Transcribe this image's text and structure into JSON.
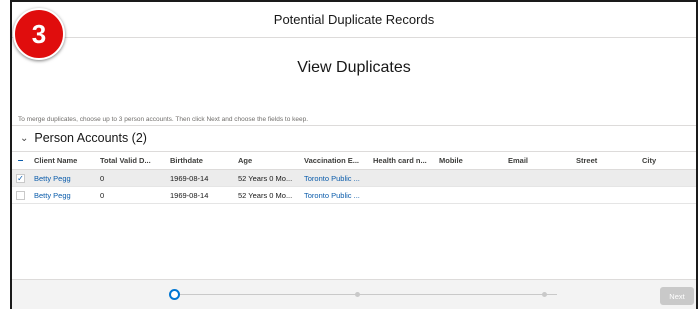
{
  "badge": {
    "number": "3"
  },
  "modal": {
    "title": "Potential Duplicate Records",
    "subtitle": "View Duplicates",
    "instructions": "To merge duplicates, choose up to 3 person accounts. Then click Next and choose the fields to keep."
  },
  "section": {
    "label": "Person Accounts (2)"
  },
  "table": {
    "columns": {
      "client": "Client Name",
      "valid": "Total Valid D...",
      "birth": "Birthdate",
      "age": "Age",
      "vacc": "Vaccination E...",
      "health": "Health card n...",
      "mobile": "Mobile",
      "email": "Email",
      "street": "Street",
      "city": "City"
    },
    "rows": [
      {
        "checked": true,
        "client": "Betty Pegg",
        "valid": "0",
        "birth": "1969-08-14",
        "age": "52 Years 0 Mo...",
        "vacc": "Toronto Public ...",
        "health": "",
        "mobile": "",
        "email": "",
        "street": "",
        "city": ""
      },
      {
        "checked": false,
        "client": "Betty Pegg",
        "valid": "0",
        "birth": "1969-08-14",
        "age": "52 Years 0 Mo...",
        "vacc": "Toronto Public ...",
        "health": "",
        "mobile": "",
        "email": "",
        "street": "",
        "city": ""
      }
    ]
  },
  "footer": {
    "next_label": "Next"
  },
  "colors": {
    "accent": "#0176d3",
    "link": "#0b5cab",
    "badge": "#e00d0d"
  }
}
